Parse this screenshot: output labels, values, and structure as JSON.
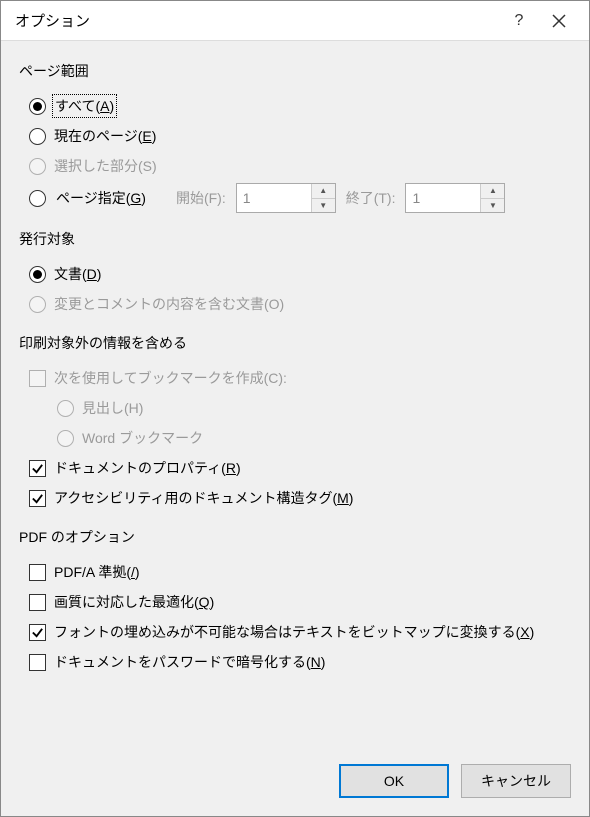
{
  "title": "オプション",
  "sections": {
    "pageRange": {
      "title": "ページ範囲",
      "all": "すべて(",
      "all_u": "A",
      "all_end": ")",
      "current": "現在のページ(",
      "current_u": "E",
      "current_end": ")",
      "selection": "選択した部分(S)",
      "pages": "ページ指定(",
      "pages_u": "G",
      "pages_end": ")",
      "from": "開始(F):",
      "to": "終了(T):",
      "fromValue": "1",
      "toValue": "1"
    },
    "publish": {
      "title": "発行対象",
      "document": "文書(",
      "document_u": "D",
      "document_end": ")",
      "withMarkup": "変更とコメントの内容を含む文書(O)"
    },
    "nonPrint": {
      "title": "印刷対象外の情報を含める",
      "createBookmarks": "次を使用してブックマークを作成(C):",
      "headings": "見出し(H)",
      "wordBookmarks": "Word ブックマーク",
      "docProps": "ドキュメントのプロパティ(",
      "docProps_u": "R",
      "docProps_end": ")",
      "accTags": "アクセシビリティ用のドキュメント構造タグ(",
      "accTags_u": "M",
      "accTags_end": ")"
    },
    "pdf": {
      "title": "PDF のオプション",
      "pdfa": "PDF/A 準拠(",
      "pdfa_u": "/",
      "pdfa_end": ")",
      "optimize": "画質に対応した最適化(",
      "optimize_u": "Q",
      "optimize_end": ")",
      "bitmap": "フォントの埋め込みが不可能な場合はテキストをビットマップに変換する(",
      "bitmap_u": "X",
      "bitmap_end": ")",
      "encrypt": "ドキュメントをパスワードで暗号化する(",
      "encrypt_u": "N",
      "encrypt_end": ")"
    }
  },
  "buttons": {
    "ok": "OK",
    "cancel": "キャンセル"
  }
}
